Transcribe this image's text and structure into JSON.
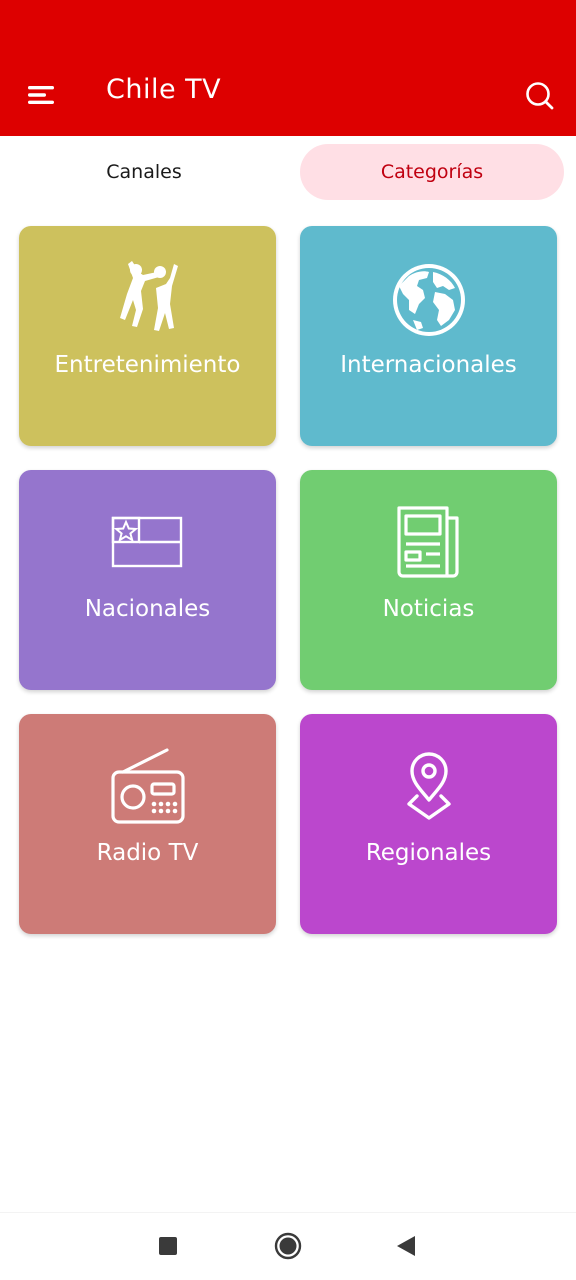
{
  "header": {
    "title": "Chile TV",
    "background_color": "#dd0000",
    "menu_icon": "menu-icon",
    "search_icon": "search-icon"
  },
  "tabs": [
    {
      "label": "Canales",
      "selected": false
    },
    {
      "label": "Categorías",
      "selected": true
    }
  ],
  "categories": [
    {
      "label": "Entretenimiento",
      "color": "#cdc15d",
      "icon": "dancing-people-icon"
    },
    {
      "label": "Internacionales",
      "color": "#5fbacd",
      "icon": "globe-icon"
    },
    {
      "label": "Nacionales",
      "color": "#9575cd",
      "icon": "chile-flag-icon"
    },
    {
      "label": "Noticias",
      "color": "#71cd71",
      "icon": "newspaper-icon"
    },
    {
      "label": "Radio TV",
      "color": "#cd7b77",
      "icon": "radio-icon"
    },
    {
      "label": "Regionales",
      "color": "#bb47cd",
      "icon": "location-pin-icon"
    }
  ],
  "system_nav": {
    "items": [
      "recents-square-icon",
      "home-circle-icon",
      "back-triangle-icon"
    ]
  }
}
